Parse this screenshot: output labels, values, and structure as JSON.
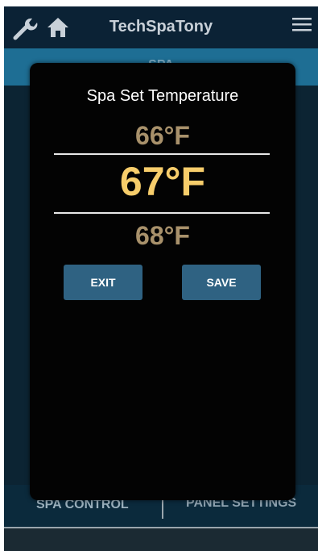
{
  "header": {
    "title": "TechSpaTony",
    "icons": [
      "wrench-icon",
      "home-icon",
      "hamburger-menu-icon"
    ]
  },
  "section": {
    "label": "SPA"
  },
  "modal": {
    "title": "Spa Set Temperature",
    "temp_prev": "66°F",
    "temp_current": "67°F",
    "temp_next": "68°F",
    "exit_label": "EXIT",
    "save_label": "SAVE"
  },
  "bottom_nav": {
    "spa_control": "SPA CONTROL",
    "panel_settings": "PANEL SETTINGS"
  },
  "colors": {
    "header_bg": "#0b2235",
    "section_bar": "#1e6e94",
    "modal_bg": "#030303",
    "current_temp": "#f7cd6b",
    "adjacent_temp": "#a8916b",
    "button_bg": "#2f6282"
  }
}
